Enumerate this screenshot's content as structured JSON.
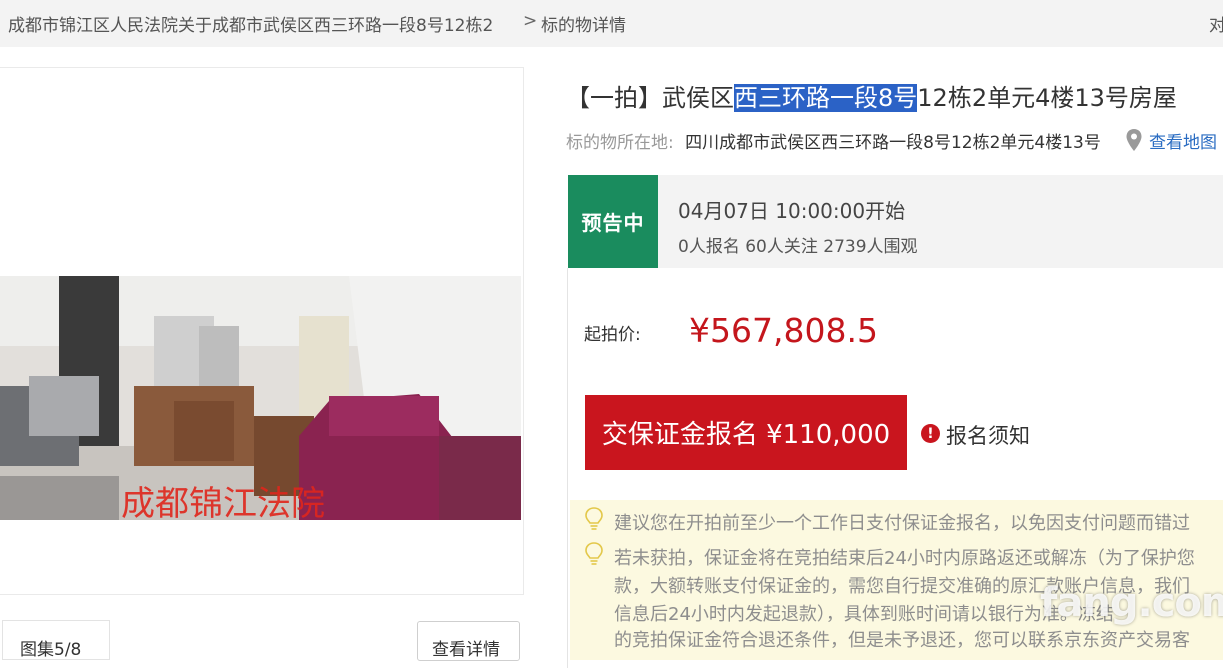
{
  "breadcrumb": {
    "court": "成都市锦江区人民法院关于成都市武侯区西三环路一段8号12栋2",
    "separator": ">",
    "current": "标的物详情",
    "right_truncated": "对"
  },
  "gallery": {
    "count": "图集5/8",
    "view_detail": "查看详情",
    "photo_watermark": "成都锦江法院"
  },
  "detail": {
    "title_prefix": "【一拍】武侯区",
    "title_highlight": "西三环路一段8号",
    "title_suffix": "12栋2单元4楼13号房屋",
    "location_label": "标的物所在地:",
    "location_value": "四川成都市武侯区西三环路一段8号12栋2单元4楼13号",
    "map_link": "查看地图"
  },
  "status": {
    "badge": "预告中",
    "start_time": "04月07日 10:00:00开始",
    "stats": "0人报名  60人关注  2739人围观"
  },
  "bid": {
    "start_label": "起拍价:",
    "start_price": "¥567,808.5",
    "deposit_button": "交保证金报名 ¥110,000",
    "notice_link": "报名须知"
  },
  "tips": {
    "tip1": "建议您在开拍前至少一个工作日支付保证金报名，以免因支付问题而错过",
    "tip2_l1": "若未获拍，保证金将在竞拍结束后24小时内原路返还或解冻（为了保护您",
    "tip2_l2": "款，大额转账支付保证金的，需您自行提交准确的原汇款账户信息，我们",
    "tip2_l3": "信息后24小时内发起退款），具体到账时间请以银行为准。冻结",
    "tip2_l4": "的竞拍保证金符合退还条件，但是未予退还，您可以联系京东资产交易客"
  },
  "site_watermark": "fang.com",
  "colors": {
    "badge_green": "#1a8c5e",
    "price_red": "#c4161c",
    "button_red": "#c9151e",
    "link_blue": "#2a6cc2",
    "highlight_blue": "#2b62c6",
    "tips_bg": "#fcf9e0"
  },
  "icons": [
    "map-pin-icon",
    "exclamation-circle-icon",
    "lightbulb-icon"
  ]
}
